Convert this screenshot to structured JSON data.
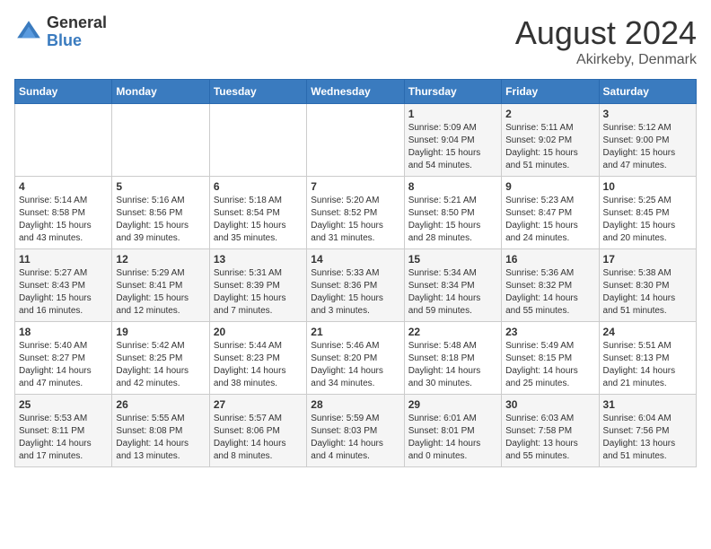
{
  "logo": {
    "general": "General",
    "blue": "Blue"
  },
  "header": {
    "title": "August 2024",
    "subtitle": "Akirkeby, Denmark"
  },
  "days_of_week": [
    "Sunday",
    "Monday",
    "Tuesday",
    "Wednesday",
    "Thursday",
    "Friday",
    "Saturday"
  ],
  "weeks": [
    [
      {
        "day": "",
        "info": ""
      },
      {
        "day": "",
        "info": ""
      },
      {
        "day": "",
        "info": ""
      },
      {
        "day": "",
        "info": ""
      },
      {
        "day": "1",
        "info": "Sunrise: 5:09 AM\nSunset: 9:04 PM\nDaylight: 15 hours\nand 54 minutes."
      },
      {
        "day": "2",
        "info": "Sunrise: 5:11 AM\nSunset: 9:02 PM\nDaylight: 15 hours\nand 51 minutes."
      },
      {
        "day": "3",
        "info": "Sunrise: 5:12 AM\nSunset: 9:00 PM\nDaylight: 15 hours\nand 47 minutes."
      }
    ],
    [
      {
        "day": "4",
        "info": "Sunrise: 5:14 AM\nSunset: 8:58 PM\nDaylight: 15 hours\nand 43 minutes."
      },
      {
        "day": "5",
        "info": "Sunrise: 5:16 AM\nSunset: 8:56 PM\nDaylight: 15 hours\nand 39 minutes."
      },
      {
        "day": "6",
        "info": "Sunrise: 5:18 AM\nSunset: 8:54 PM\nDaylight: 15 hours\nand 35 minutes."
      },
      {
        "day": "7",
        "info": "Sunrise: 5:20 AM\nSunset: 8:52 PM\nDaylight: 15 hours\nand 31 minutes."
      },
      {
        "day": "8",
        "info": "Sunrise: 5:21 AM\nSunset: 8:50 PM\nDaylight: 15 hours\nand 28 minutes."
      },
      {
        "day": "9",
        "info": "Sunrise: 5:23 AM\nSunset: 8:47 PM\nDaylight: 15 hours\nand 24 minutes."
      },
      {
        "day": "10",
        "info": "Sunrise: 5:25 AM\nSunset: 8:45 PM\nDaylight: 15 hours\nand 20 minutes."
      }
    ],
    [
      {
        "day": "11",
        "info": "Sunrise: 5:27 AM\nSunset: 8:43 PM\nDaylight: 15 hours\nand 16 minutes."
      },
      {
        "day": "12",
        "info": "Sunrise: 5:29 AM\nSunset: 8:41 PM\nDaylight: 15 hours\nand 12 minutes."
      },
      {
        "day": "13",
        "info": "Sunrise: 5:31 AM\nSunset: 8:39 PM\nDaylight: 15 hours\nand 7 minutes."
      },
      {
        "day": "14",
        "info": "Sunrise: 5:33 AM\nSunset: 8:36 PM\nDaylight: 15 hours\nand 3 minutes."
      },
      {
        "day": "15",
        "info": "Sunrise: 5:34 AM\nSunset: 8:34 PM\nDaylight: 14 hours\nand 59 minutes."
      },
      {
        "day": "16",
        "info": "Sunrise: 5:36 AM\nSunset: 8:32 PM\nDaylight: 14 hours\nand 55 minutes."
      },
      {
        "day": "17",
        "info": "Sunrise: 5:38 AM\nSunset: 8:30 PM\nDaylight: 14 hours\nand 51 minutes."
      }
    ],
    [
      {
        "day": "18",
        "info": "Sunrise: 5:40 AM\nSunset: 8:27 PM\nDaylight: 14 hours\nand 47 minutes."
      },
      {
        "day": "19",
        "info": "Sunrise: 5:42 AM\nSunset: 8:25 PM\nDaylight: 14 hours\nand 42 minutes."
      },
      {
        "day": "20",
        "info": "Sunrise: 5:44 AM\nSunset: 8:23 PM\nDaylight: 14 hours\nand 38 minutes."
      },
      {
        "day": "21",
        "info": "Sunrise: 5:46 AM\nSunset: 8:20 PM\nDaylight: 14 hours\nand 34 minutes."
      },
      {
        "day": "22",
        "info": "Sunrise: 5:48 AM\nSunset: 8:18 PM\nDaylight: 14 hours\nand 30 minutes."
      },
      {
        "day": "23",
        "info": "Sunrise: 5:49 AM\nSunset: 8:15 PM\nDaylight: 14 hours\nand 25 minutes."
      },
      {
        "day": "24",
        "info": "Sunrise: 5:51 AM\nSunset: 8:13 PM\nDaylight: 14 hours\nand 21 minutes."
      }
    ],
    [
      {
        "day": "25",
        "info": "Sunrise: 5:53 AM\nSunset: 8:11 PM\nDaylight: 14 hours\nand 17 minutes."
      },
      {
        "day": "26",
        "info": "Sunrise: 5:55 AM\nSunset: 8:08 PM\nDaylight: 14 hours\nand 13 minutes."
      },
      {
        "day": "27",
        "info": "Sunrise: 5:57 AM\nSunset: 8:06 PM\nDaylight: 14 hours\nand 8 minutes."
      },
      {
        "day": "28",
        "info": "Sunrise: 5:59 AM\nSunset: 8:03 PM\nDaylight: 14 hours\nand 4 minutes."
      },
      {
        "day": "29",
        "info": "Sunrise: 6:01 AM\nSunset: 8:01 PM\nDaylight: 14 hours\nand 0 minutes."
      },
      {
        "day": "30",
        "info": "Sunrise: 6:03 AM\nSunset: 7:58 PM\nDaylight: 13 hours\nand 55 minutes."
      },
      {
        "day": "31",
        "info": "Sunrise: 6:04 AM\nSunset: 7:56 PM\nDaylight: 13 hours\nand 51 minutes."
      }
    ]
  ]
}
